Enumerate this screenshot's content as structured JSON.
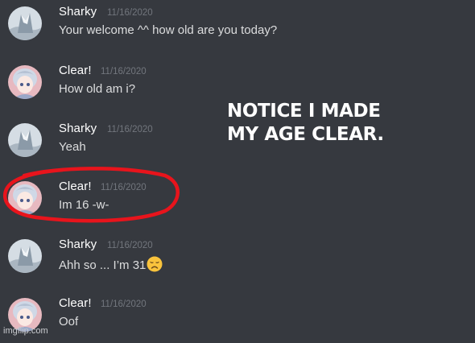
{
  "messages": [
    {
      "author": "Sharky",
      "timestamp": "11/16/2020",
      "text": "Your welcome ^^ how old are you today?",
      "avatar": "sharky-avatar"
    },
    {
      "author": "Clear!",
      "timestamp": "11/16/2020",
      "text": "How old am i?",
      "avatar": "clear-avatar"
    },
    {
      "author": "Sharky",
      "timestamp": "11/16/2020",
      "text": "Yeah",
      "avatar": "sharky-avatar"
    },
    {
      "author": "Clear!",
      "timestamp": "11/16/2020",
      "text": "Im 16 -w-",
      "avatar": "clear-avatar"
    },
    {
      "author": "Sharky",
      "timestamp": "11/16/2020",
      "text": "Ahh so ... I’m 31",
      "emoji": "disappointed-face-emoji",
      "avatar": "sharky-avatar"
    },
    {
      "author": "Clear!",
      "timestamp": "11/16/2020",
      "text": "Oof",
      "avatar": "clear-avatar"
    }
  ],
  "annotation": {
    "line1": "NOTICE I MADE",
    "line2": "MY AGE CLEAR."
  },
  "highlight": {
    "color": "#e8141c",
    "target": "message 4"
  },
  "watermark": "imgflip.com",
  "colors": {
    "background": "#36393f",
    "username": "#ffffff",
    "message_text": "#dcddde",
    "timestamp": "#72767d"
  }
}
